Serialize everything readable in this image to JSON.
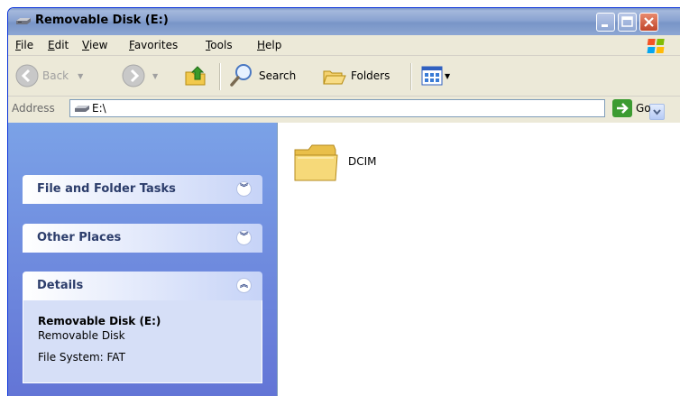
{
  "window": {
    "title": "Removable Disk (E:)"
  },
  "menu": [
    "File",
    "Edit",
    "View",
    "Favorites",
    "Tools",
    "Help"
  ],
  "toolbar": {
    "back_label": "Back",
    "search_label": "Search",
    "folders_label": "Folders"
  },
  "address": {
    "label": "Address",
    "value": "E:\\",
    "go_label": "Go"
  },
  "tasks": {
    "file_folder_tasks": "File and Folder Tasks",
    "other_places": "Other Places",
    "details": "Details",
    "details_name": "Removable Disk (E:)",
    "details_type": "Removable Disk",
    "details_fs": "File System: FAT"
  },
  "files": [
    {
      "name": "DCIM",
      "icon": "folder-icon"
    }
  ],
  "colors": {
    "titlebar": "#8aa3d1",
    "task_pane": "#7ba2e7",
    "details_bg": "#d6dff7"
  }
}
